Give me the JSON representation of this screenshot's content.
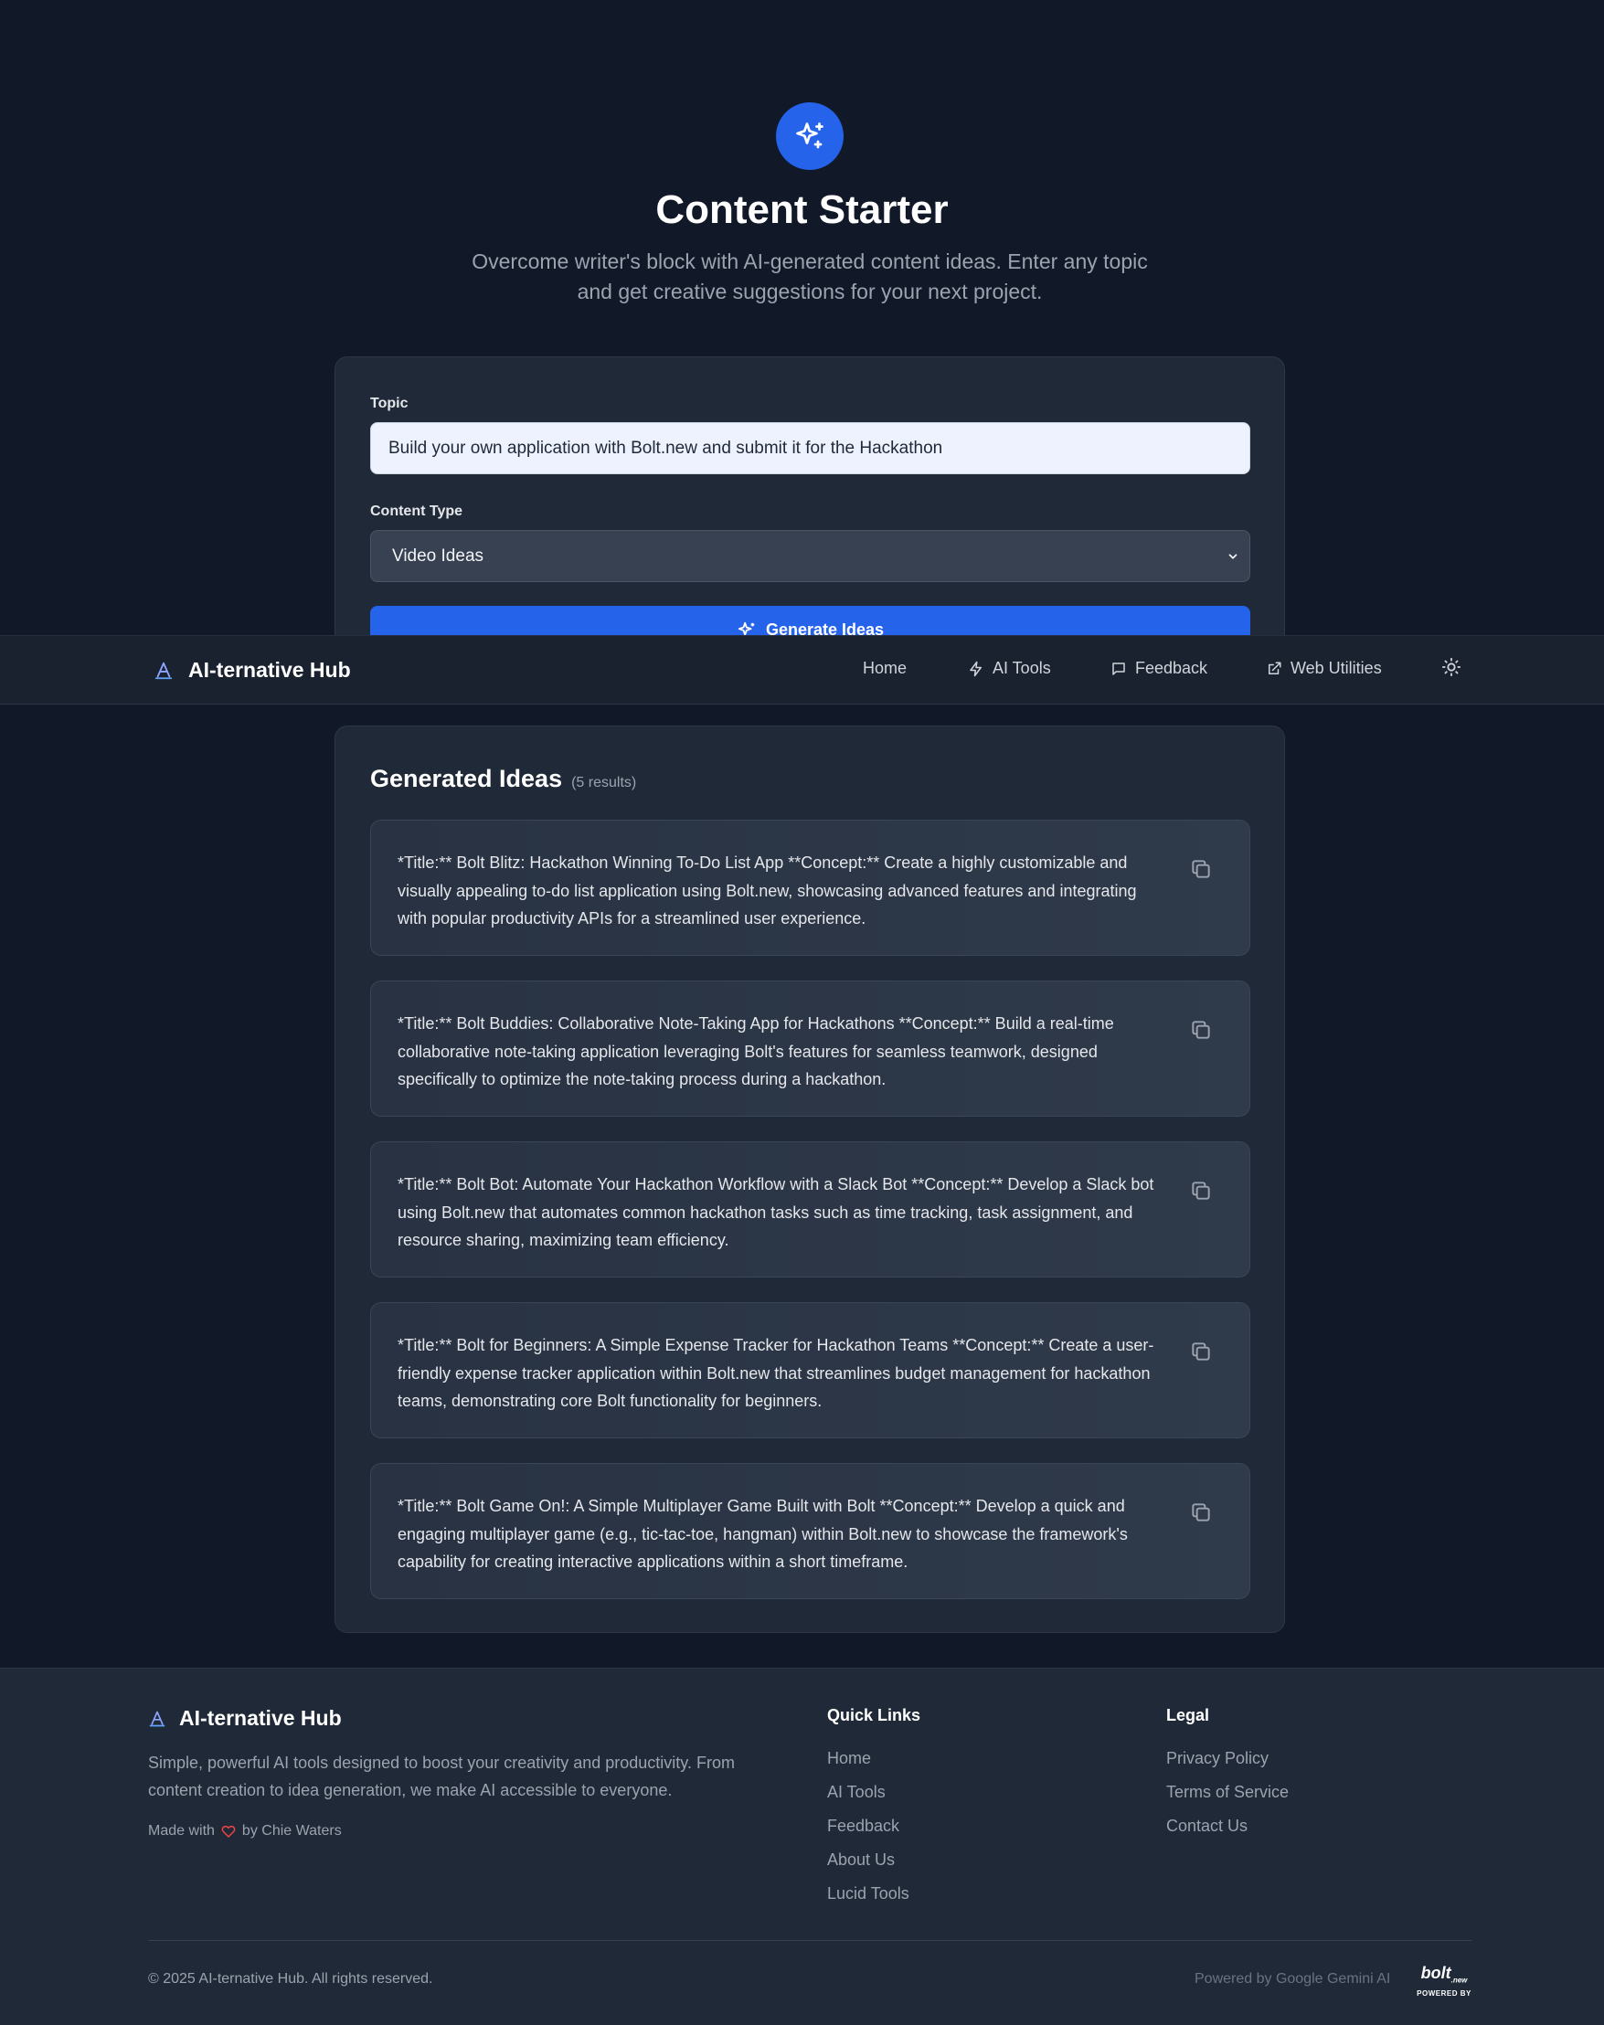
{
  "hero": {
    "icon": "sparkles-icon",
    "title": "Content Starter",
    "subtitle": "Overcome writer's block with AI-generated content ideas. Enter any topic and get creative suggestions for your next project."
  },
  "form": {
    "topic_label": "Topic",
    "topic_value": "Build your own application with Bolt.new and submit it for the Hackathon",
    "content_type_label": "Content Type",
    "content_type_value": "Video Ideas",
    "generate_label": "Generate Ideas"
  },
  "nav": {
    "brand": "AI-ternative Hub",
    "items": [
      {
        "label": "Home",
        "icon": ""
      },
      {
        "label": "AI Tools",
        "icon": "zap-icon"
      },
      {
        "label": "Feedback",
        "icon": "message-icon"
      },
      {
        "label": "Web Utilities",
        "icon": "external-link-icon"
      }
    ],
    "theme_icon": "sun-icon"
  },
  "results": {
    "title": "Generated Ideas",
    "count": "(5 results)",
    "ideas": [
      "*Title:** Bolt Blitz: Hackathon Winning To-Do List App **Concept:** Create a highly customizable and visually appealing to-do list application using Bolt.new, showcasing advanced features and integrating with popular productivity APIs for a streamlined user experience.",
      "*Title:** Bolt Buddies: Collaborative Note-Taking App for Hackathons **Concept:** Build a real-time collaborative note-taking application leveraging Bolt's features for seamless teamwork, designed specifically to optimize the note-taking process during a hackathon.",
      "*Title:** Bolt Bot: Automate Your Hackathon Workflow with a Slack Bot **Concept:** Develop a Slack bot using Bolt.new that automates common hackathon tasks such as time tracking, task assignment, and resource sharing, maximizing team efficiency.",
      "*Title:** Bolt for Beginners: A Simple Expense Tracker for Hackathon Teams **Concept:** Create a user-friendly expense tracker application within Bolt.new that streamlines budget management for hackathon teams, demonstrating core Bolt functionality for beginners.",
      "*Title:** Bolt Game On!: A Simple Multiplayer Game Built with Bolt **Concept:** Develop a quick and engaging multiplayer game (e.g., tic-tac-toe, hangman) within Bolt.new to showcase the framework's capability for creating interactive applications within a short timeframe."
    ]
  },
  "footer": {
    "brand": "AI-ternative Hub",
    "description": "Simple, powerful AI tools designed to boost your creativity and productivity. From content creation to idea generation, we make AI accessible to everyone.",
    "made_with_prefix": "Made with",
    "made_with_suffix": "by Chie Waters",
    "quick_links_title": "Quick Links",
    "quick_links": [
      "Home",
      "AI Tools",
      "Feedback",
      "About Us",
      "Lucid Tools"
    ],
    "legal_title": "Legal",
    "legal_links": [
      "Privacy Policy",
      "Terms of Service",
      "Contact Us"
    ],
    "copyright": "© 2025 AI-ternative Hub. All rights reserved.",
    "powered_by": "Powered by Google Gemini AI",
    "bolt_badge_top": "bolt",
    "bolt_badge_sub": ".new",
    "bolt_badge_bottom": "POWERED BY"
  },
  "colors": {
    "background": "#111827",
    "card": "#1f2937",
    "accent": "#2563eb",
    "heart": "#ef4444"
  }
}
